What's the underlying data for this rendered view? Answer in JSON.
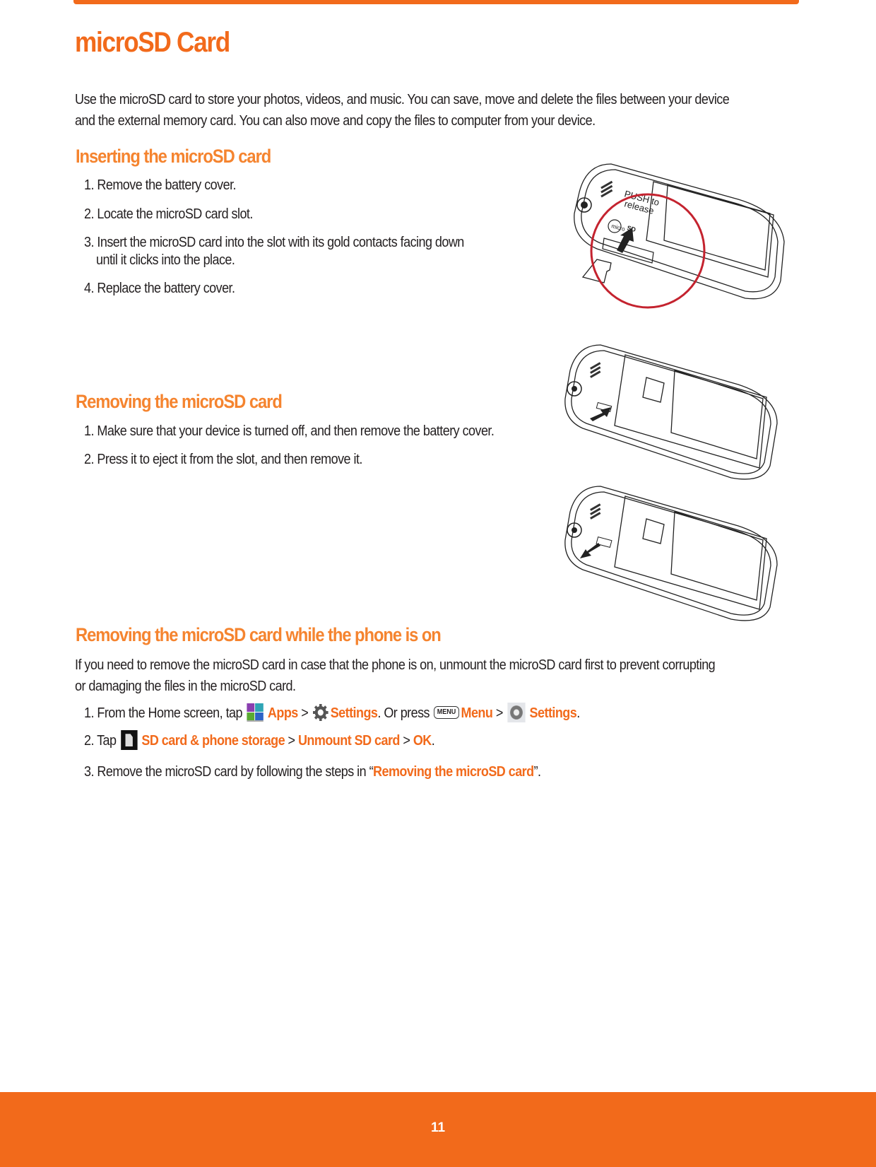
{
  "page": {
    "title": "microSD Card",
    "intro": [
      "Use the microSD card to store your photos, videos, and music. You can save, move and delete the files between your device",
      "and the external memory card. You can also move and copy the files to computer from your device."
    ],
    "accent_color": "#f26a1b",
    "heading_color": "#f5842f"
  },
  "inserting": {
    "heading": "Inserting the microSD card",
    "steps": [
      "1. Remove the battery cover.",
      "2. Locate the microSD card slot.",
      "3. Insert the microSD card into the slot with its gold contacts facing down",
      "until it clicks into the place.",
      "4. Replace the battery cover."
    ],
    "figure_labels": {
      "push": "PUSH to",
      "release": "release",
      "micro": "micro",
      "sd": "SD"
    }
  },
  "removing": {
    "heading": "Removing the microSD card",
    "steps": [
      "1. Make sure that your device is turned off, and then remove the battery cover.",
      "2. Press it to eject it from the slot, and then remove it."
    ]
  },
  "removing_on": {
    "heading": "Removing the microSD card while the phone is on",
    "para": [
      "If you need to remove the microSD card in case that the phone is on, unmount the microSD card first to prevent corrupting",
      "or damaging the files in the microSD card."
    ],
    "step1": {
      "prefix": "1. From the Home screen, tap",
      "apps": "Apps",
      "sep1": ">",
      "settings": "Settings",
      "mid": ". Or press",
      "menu_key": "MENU",
      "menu": "Menu",
      "sep2": ">",
      "settings2": "Settings",
      "end": "."
    },
    "step2": {
      "prefix": "2. Tap",
      "storage": "SD card & phone storage",
      "sep1": ">",
      "unmount": "Unmount SD card",
      "sep2": ">",
      "ok": "OK",
      "end": "."
    },
    "step3": {
      "prefix": "3. Remove the microSD card by following the steps in “",
      "link": "Removing the microSD card",
      "end": "”."
    }
  },
  "footer": {
    "page_number": "11"
  }
}
